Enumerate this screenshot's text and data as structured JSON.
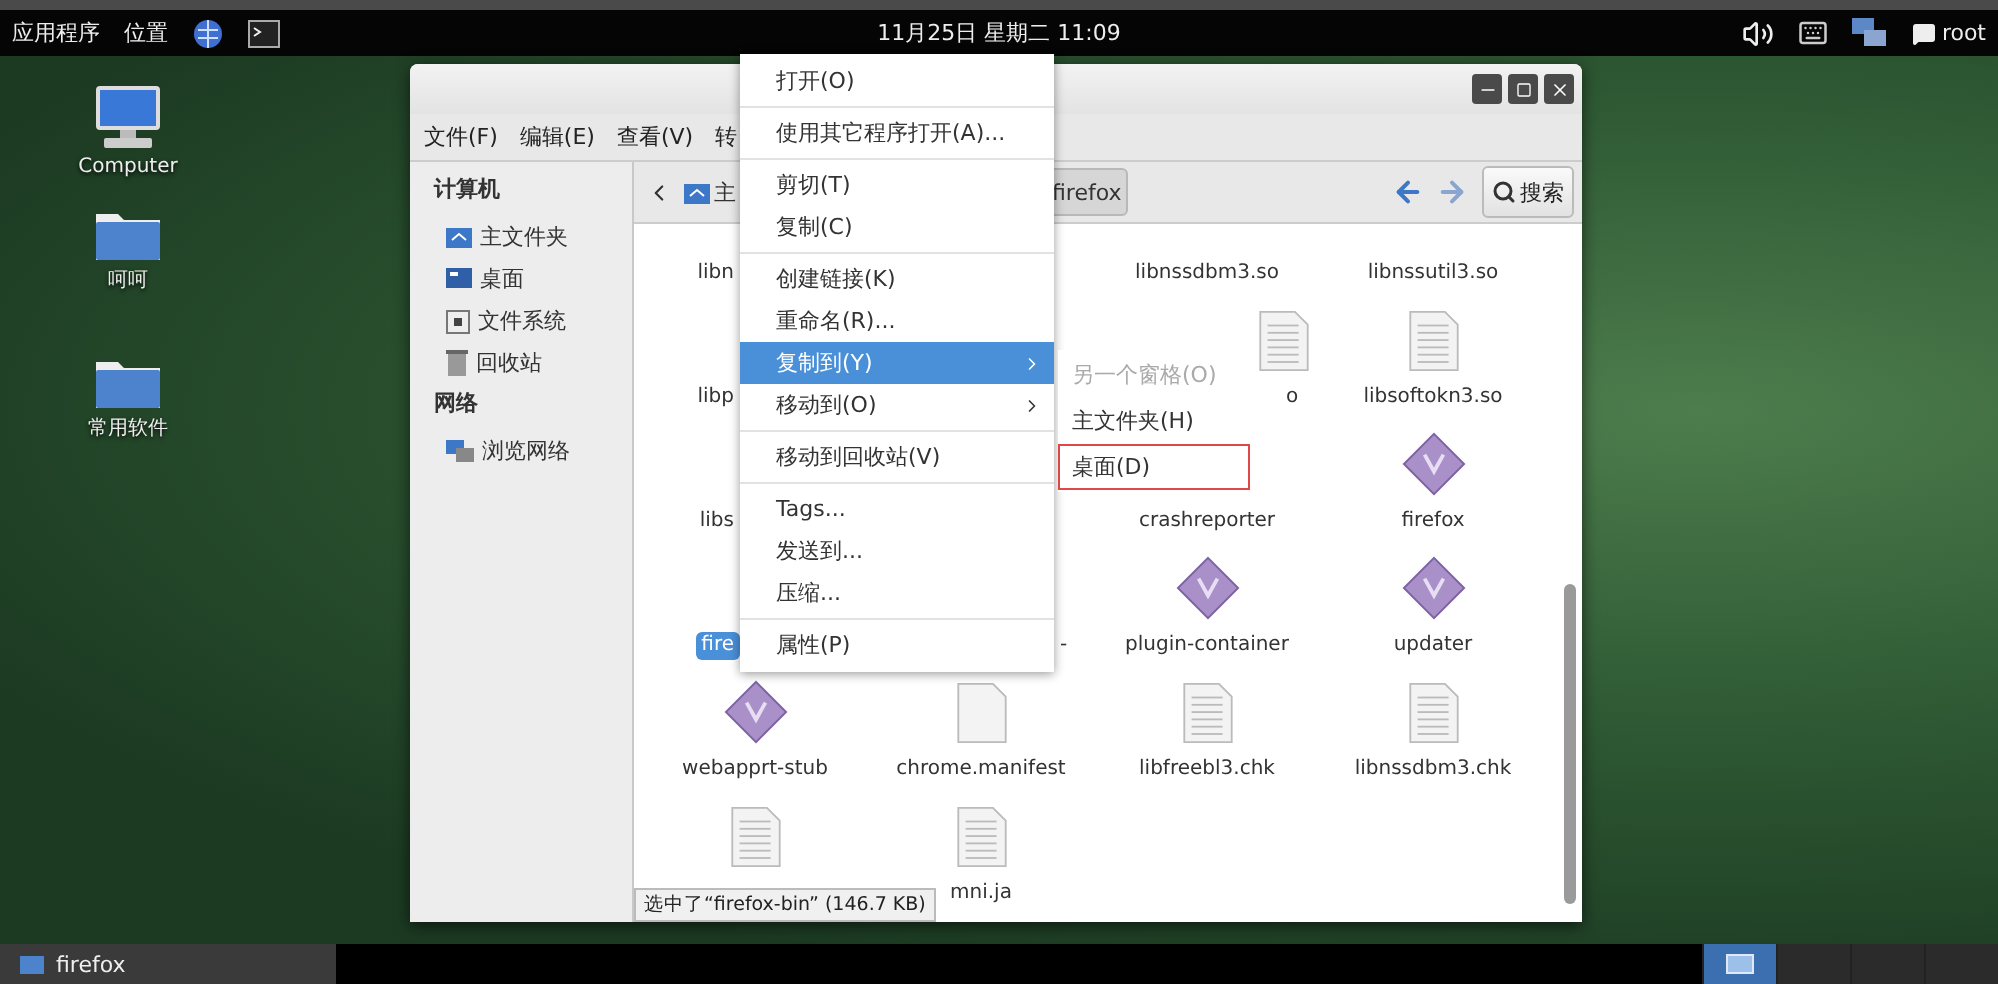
{
  "top_bar": {
    "menus": [
      "应用程序",
      "位置"
    ],
    "clock": "11月25日 星期二 11:09",
    "user": "root"
  },
  "desktop_icons": [
    {
      "kind": "computer",
      "label": "Computer"
    },
    {
      "kind": "folder",
      "label": "呵呵"
    },
    {
      "kind": "folder",
      "label": "常用软件"
    }
  ],
  "window": {
    "menu_bar": [
      "文件(F)",
      "编辑(E)",
      "查看(V)",
      "转"
    ],
    "sidebar": [
      {
        "heading": "计算机",
        "items": [
          {
            "kind": "home",
            "label": "主文件夹"
          },
          {
            "kind": "desktop",
            "label": "桌面"
          },
          {
            "kind": "drive",
            "label": "文件系统"
          },
          {
            "kind": "trash",
            "label": "回收站"
          }
        ]
      },
      {
        "heading": "网络",
        "items": [
          {
            "kind": "network",
            "label": "浏览网络"
          }
        ]
      }
    ],
    "path": [
      {
        "label": "主",
        "selected": false
      },
      {
        "label": "firefox",
        "selected": true
      }
    ],
    "search_button": "搜索",
    "grid": [
      [
        {
          "kind": "cut_end",
          "label": "libn",
          "selected": false
        },
        {
          "kind": "covered"
        },
        {
          "kind": "label_only",
          "label": "libnssdbm3.so",
          "selected": false
        },
        {
          "kind": "label_only",
          "label": "libnssutil3.so",
          "selected": false
        }
      ],
      [
        {
          "kind": "cut_end",
          "label": "libp",
          "selected": false
        },
        {
          "kind": "covered"
        },
        {
          "kind": "cut_start_document",
          "label": "o",
          "selected": false
        },
        {
          "kind": "document",
          "label": "libsoftokn3.so",
          "selected": false
        }
      ],
      [
        {
          "kind": "cut_end",
          "label": "libs",
          "selected": false
        },
        {
          "kind": "covered"
        },
        {
          "kind": "label_only",
          "label": "crashreporter",
          "selected": false
        },
        {
          "kind": "executable",
          "label": "firefox",
          "selected": false
        }
      ],
      [
        {
          "kind": "cut_end",
          "label": "fire",
          "selected": true
        },
        {
          "kind": "cut_start",
          "label": "-",
          "selected": false
        },
        {
          "kind": "executable",
          "label": "plugin-container",
          "selected": false
        },
        {
          "kind": "executable",
          "label": "updater",
          "selected": false
        }
      ],
      [
        {
          "kind": "executable",
          "label": "webapprt-stub",
          "selected": false
        },
        {
          "kind": "blank",
          "label": "chrome.manifest",
          "selected": false
        },
        {
          "kind": "document",
          "label": "libfreebl3.chk",
          "selected": false
        },
        {
          "kind": "document",
          "label": "libnssdbm3.chk",
          "selected": false
        }
      ],
      [
        {
          "kind": "document"
        },
        {
          "kind": "document",
          "label": "mni.ja",
          "selected": false
        }
      ]
    ],
    "status": "选中了“firefox-bin” (146.7 KB)"
  },
  "context_menu": [
    [
      {
        "label": "打开(O)",
        "selected": false,
        "has_submenu": false
      }
    ],
    [
      {
        "label": "使用其它程序打开(A)...",
        "selected": false,
        "has_submenu": false
      }
    ],
    [
      {
        "label": "剪切(T)",
        "selected": false,
        "has_submenu": false
      },
      {
        "label": "复制(C)",
        "selected": false,
        "has_submenu": false
      }
    ],
    [
      {
        "label": "创建链接(K)",
        "selected": false,
        "has_submenu": false
      },
      {
        "label": "重命名(R)...",
        "selected": false,
        "has_submenu": false
      },
      {
        "label": "复制到(Y)",
        "selected": true,
        "has_submenu": true
      },
      {
        "label": "移动到(O)",
        "selected": false,
        "has_submenu": true
      }
    ],
    [
      {
        "label": "移动到回收站(V)",
        "selected": false,
        "has_submenu": false
      }
    ],
    [
      {
        "label": "Tags...",
        "selected": false,
        "has_submenu": false
      },
      {
        "label": "发送到...",
        "selected": false,
        "has_submenu": false
      },
      {
        "label": "压缩...",
        "selected": false,
        "has_submenu": false
      }
    ],
    [
      {
        "label": "属性(P)",
        "selected": false,
        "has_submenu": false
      }
    ]
  ],
  "submenu": [
    {
      "label": "另一个窗格(O)",
      "disabled": true,
      "outlined": false
    },
    {
      "label": "主文件夹(H)",
      "disabled": false,
      "outlined": false
    },
    {
      "label": "桌面(D)",
      "disabled": false,
      "outlined": true
    }
  ],
  "taskbar": {
    "tasks": [
      {
        "label": "firefox",
        "selected": false
      }
    ],
    "workspaces": [
      {
        "selected": true
      },
      {
        "selected": false
      },
      {
        "selected": false
      },
      {
        "selected": false
      }
    ]
  }
}
